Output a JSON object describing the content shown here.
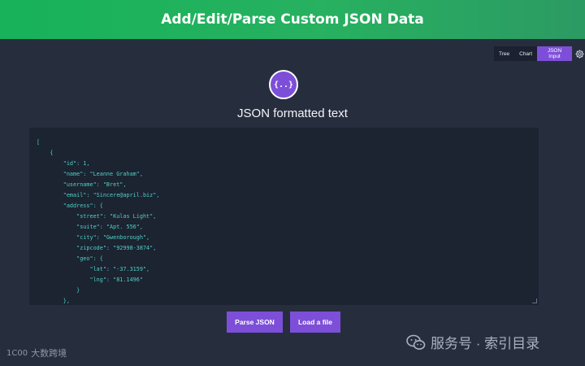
{
  "header": {
    "title": "Add/Edit/Parse Custom JSON Data"
  },
  "view_switch": {
    "tabs": [
      {
        "label": "Tree",
        "active": false
      },
      {
        "label": "Chart",
        "active": false
      },
      {
        "label": "JSON Input",
        "active": true
      }
    ],
    "settings_icon": "gear-icon"
  },
  "logo": {
    "glyph": "{..}",
    "icon": "json-braces-icon"
  },
  "main": {
    "heading": "JSON formatted text"
  },
  "editor": {
    "lines": [
      "[",
      "    {",
      "        \"id\": 1,",
      "        \"name\": \"Leanne Graham\",",
      "        \"username\": \"Bret\",",
      "        \"email\": \"Sincere@april.biz\",",
      "        \"address\": {",
      "            \"street\": \"Kulas Light\",",
      "            \"suite\": \"Apt. 556\",",
      "            \"city\": \"Gwenborough\",",
      "            \"zipcode\": \"92998-3874\",",
      "            \"geo\": {",
      "                \"lat\": \"-37.3159\",",
      "                \"lng\": \"81.1496\"",
      "            }",
      "        },"
    ]
  },
  "actions": {
    "parse_label": "Parse JSON",
    "load_label": "Load a file"
  },
  "watermarks": {
    "left_text": "大数跨境",
    "left_logo": "1C00",
    "right_text": "服务号 · 索引目录"
  },
  "colors": {
    "accent": "#7d4fd8",
    "banner": "#27b160",
    "background": "#262e3e",
    "editor_bg": "#1c2331",
    "code_text": "#4fd1c5"
  }
}
